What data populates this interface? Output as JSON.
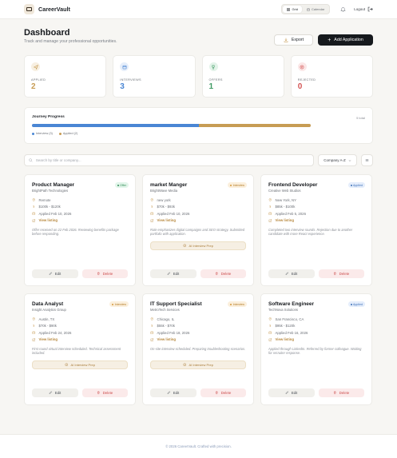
{
  "app": {
    "name": "CareerVault"
  },
  "nav": {
    "views": [
      {
        "label": "Grid",
        "icon": "grid-icon",
        "active": true
      },
      {
        "label": "Calendar",
        "icon": "calendar-icon",
        "active": false
      }
    ],
    "logout_label": "Logout"
  },
  "header": {
    "title": "Dashboard",
    "subtitle": "Track and manage your professional opportunities.",
    "export_label": "Export",
    "add_label": "Add Application"
  },
  "stats": [
    {
      "label": "APPLIED",
      "value": "2",
      "icon": "send-icon",
      "color": "#c79c54",
      "bg": "#f7efe1"
    },
    {
      "label": "INTERVIEWS",
      "value": "3",
      "icon": "calendar-icon",
      "color": "#4a86d4",
      "bg": "#e6eefa"
    },
    {
      "label": "OFFERS",
      "value": "1",
      "icon": "trophy-icon",
      "color": "#3f9a64",
      "bg": "#e3f3e9"
    },
    {
      "label": "REJECTED",
      "value": "0",
      "icon": "x-circle-icon",
      "color": "#d45555",
      "bg": "#fbe7e7"
    }
  ],
  "progress": {
    "title": "Journey Progress",
    "total": "5 total",
    "segments": [
      {
        "label": "Interview (3)",
        "fraction": 0.6,
        "color": "#4a86d4"
      },
      {
        "label": "Applied (2)",
        "fraction": 0.4,
        "color": "#c79c54"
      }
    ]
  },
  "filters": {
    "search_placeholder": "Search by title or company...",
    "sort_label": "Company A-Z"
  },
  "cards": [
    {
      "title": "Product Manager",
      "company": "BrightPath Technologies",
      "status": "Offer",
      "status_class": "offer",
      "location": "Remote",
      "salary": "$100k - $120k",
      "applied": "Applied Feb 10, 2026",
      "link": "View listing",
      "notes": "Offer received on 22 Feb 2026. Reviewing benefits package before responding.",
      "prep": "",
      "edit": "Edit",
      "delete": "Delete"
    },
    {
      "title": "market Manger",
      "company": "BrightWave Media",
      "status": "Interview",
      "status_class": "interview",
      "location": "new york",
      "salary": "$70k - $93k",
      "applied": "Applied Feb 10, 2026",
      "link": "View listing",
      "notes": "Role emphasizes digital campaigns and SEO strategy. Submitted portfolio with application.",
      "prep": "AI Interview Prep",
      "edit": "Edit",
      "delete": "Delete"
    },
    {
      "title": "Frontend Developer",
      "company": "Creative Web Studios",
      "status": "Applied",
      "status_class": "applied",
      "location": "New York, NY",
      "salary": "$85k - $100k",
      "applied": "Applied Feb 5, 2026",
      "link": "View listing",
      "notes": "Completed two interview rounds. Rejection due to another candidate with more React experience.",
      "prep": "",
      "edit": "Edit",
      "delete": "Delete"
    },
    {
      "title": "Data Analyst",
      "company": "Insight Analytics Group",
      "status": "Interview",
      "status_class": "interview",
      "location": "Austin, TX",
      "salary": "$70k - $90k",
      "applied": "Applied Feb 24, 2026",
      "link": "View listing",
      "notes": "First round virtual interview scheduled. Technical assessment included.",
      "prep": "AI Interview Prep",
      "edit": "Edit",
      "delete": "Delete"
    },
    {
      "title": "IT Support Specialist",
      "company": "MetroTech Services",
      "status": "Interview",
      "status_class": "interview",
      "location": "Chicago, IL",
      "salary": "$55k - $70k",
      "applied": "Applied Feb 18, 2026",
      "link": "View listing",
      "notes": "On-site interview scheduled. Preparing troubleshooting scenarios.",
      "prep": "AI Interview Prep",
      "edit": "Edit",
      "delete": "Delete"
    },
    {
      "title": "Software Engineer",
      "company": "TechNova Solutions",
      "status": "Applied",
      "status_class": "applied",
      "location": "San Francisco, CA",
      "salary": "$95k - $120k",
      "applied": "Applied Feb 16, 2026",
      "link": "View listing",
      "notes": "Applied through LinkedIn. Referred by former colleague. Waiting for recruiter response.",
      "prep": "",
      "edit": "Edit",
      "delete": "Delete"
    }
  ],
  "footer": {
    "text": "© 2026 CareerVault. Crafted with precision."
  }
}
